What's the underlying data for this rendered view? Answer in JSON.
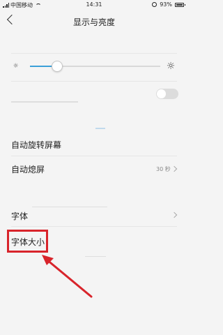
{
  "status_bar": {
    "carrier": "中国移动",
    "time": "14:31",
    "battery": "93%"
  },
  "header": {
    "title": "显示与亮度"
  },
  "brightness": {
    "level": 0.21
  },
  "settings": {
    "auto_rotate_label": "自动旋转屏幕",
    "auto_lock_label": "自动熄屏",
    "auto_lock_value": "30 秒",
    "font_label": "字体",
    "font_size_label": "字体大小"
  },
  "colors": {
    "accent": "#3aa0d8",
    "highlight": "#d8242b"
  }
}
